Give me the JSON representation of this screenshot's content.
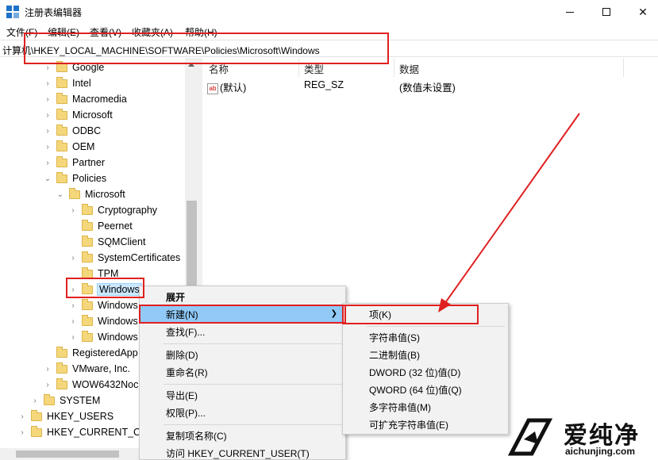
{
  "window": {
    "title": "注册表编辑器",
    "controls": {
      "minimize": "minimize-icon",
      "maximize": "maximize-icon",
      "close": "✕"
    }
  },
  "menubar": [
    "文件(F)",
    "编辑(E)",
    "查看(V)",
    "收藏夹(A)",
    "帮助(H)"
  ],
  "address": "计算机\\HKEY_LOCAL_MACHINE\\SOFTWARE\\Policies\\Microsoft\\Windows",
  "tree": [
    {
      "label": "Google",
      "state": "collapsed"
    },
    {
      "label": "Intel",
      "state": "collapsed"
    },
    {
      "label": "Macromedia",
      "state": "collapsed"
    },
    {
      "label": "Microsoft",
      "state": "collapsed"
    },
    {
      "label": "ODBC",
      "state": "collapsed"
    },
    {
      "label": "OEM",
      "state": "collapsed"
    },
    {
      "label": "Partner",
      "state": "collapsed"
    },
    {
      "label": "Policies",
      "state": "expanded"
    },
    {
      "label": "Microsoft",
      "state": "expanded"
    },
    {
      "label": "Cryptography",
      "state": "collapsed"
    },
    {
      "label": "Peernet",
      "state": "leaf"
    },
    {
      "label": "SQMClient",
      "state": "leaf"
    },
    {
      "label": "SystemCertificates",
      "state": "collapsed"
    },
    {
      "label": "TPM",
      "state": "leaf"
    },
    {
      "label": "Windows",
      "state": "selected"
    },
    {
      "label": "Windows",
      "state": "collapsed"
    },
    {
      "label": "Windows",
      "state": "collapsed"
    },
    {
      "label": "Windows",
      "state": "collapsed"
    },
    {
      "label": "RegisteredApp",
      "state": "leaf"
    },
    {
      "label": "VMware, Inc.",
      "state": "collapsed"
    },
    {
      "label": "WOW6432Noc",
      "state": "collapsed"
    },
    {
      "label": "SYSTEM",
      "state": "collapsed"
    },
    {
      "label": "HKEY_USERS",
      "state": "collapsed"
    },
    {
      "label": "HKEY_CURRENT_CO",
      "state": "collapsed"
    }
  ],
  "list": {
    "columns": [
      "名称",
      "类型",
      "数据"
    ],
    "rows": [
      {
        "name": "(默认)",
        "type": "REG_SZ",
        "data": "(数值未设置)",
        "icon": "ab"
      }
    ]
  },
  "context_menu": {
    "items": [
      "展开",
      "新建(N)",
      "查找(F)...",
      "删除(D)",
      "重命名(R)",
      "导出(E)",
      "权限(P)...",
      "复制项名称(C)",
      "访问 HKEY_CURRENT_USER(T)"
    ],
    "highlighted": "新建(N)"
  },
  "submenu": {
    "items": [
      "项(K)",
      "字符串值(S)",
      "二进制值(B)",
      "DWORD (32 位)值(D)",
      "QWORD (64 位)值(Q)",
      "多字符串值(M)",
      "可扩充字符串值(E)"
    ]
  },
  "watermark": {
    "main": "爱纯净",
    "sub": "aichunjing.com"
  },
  "colors": {
    "annotation": "#e02020",
    "highlight": "#91c9f7",
    "selection": "#cce8ff"
  }
}
